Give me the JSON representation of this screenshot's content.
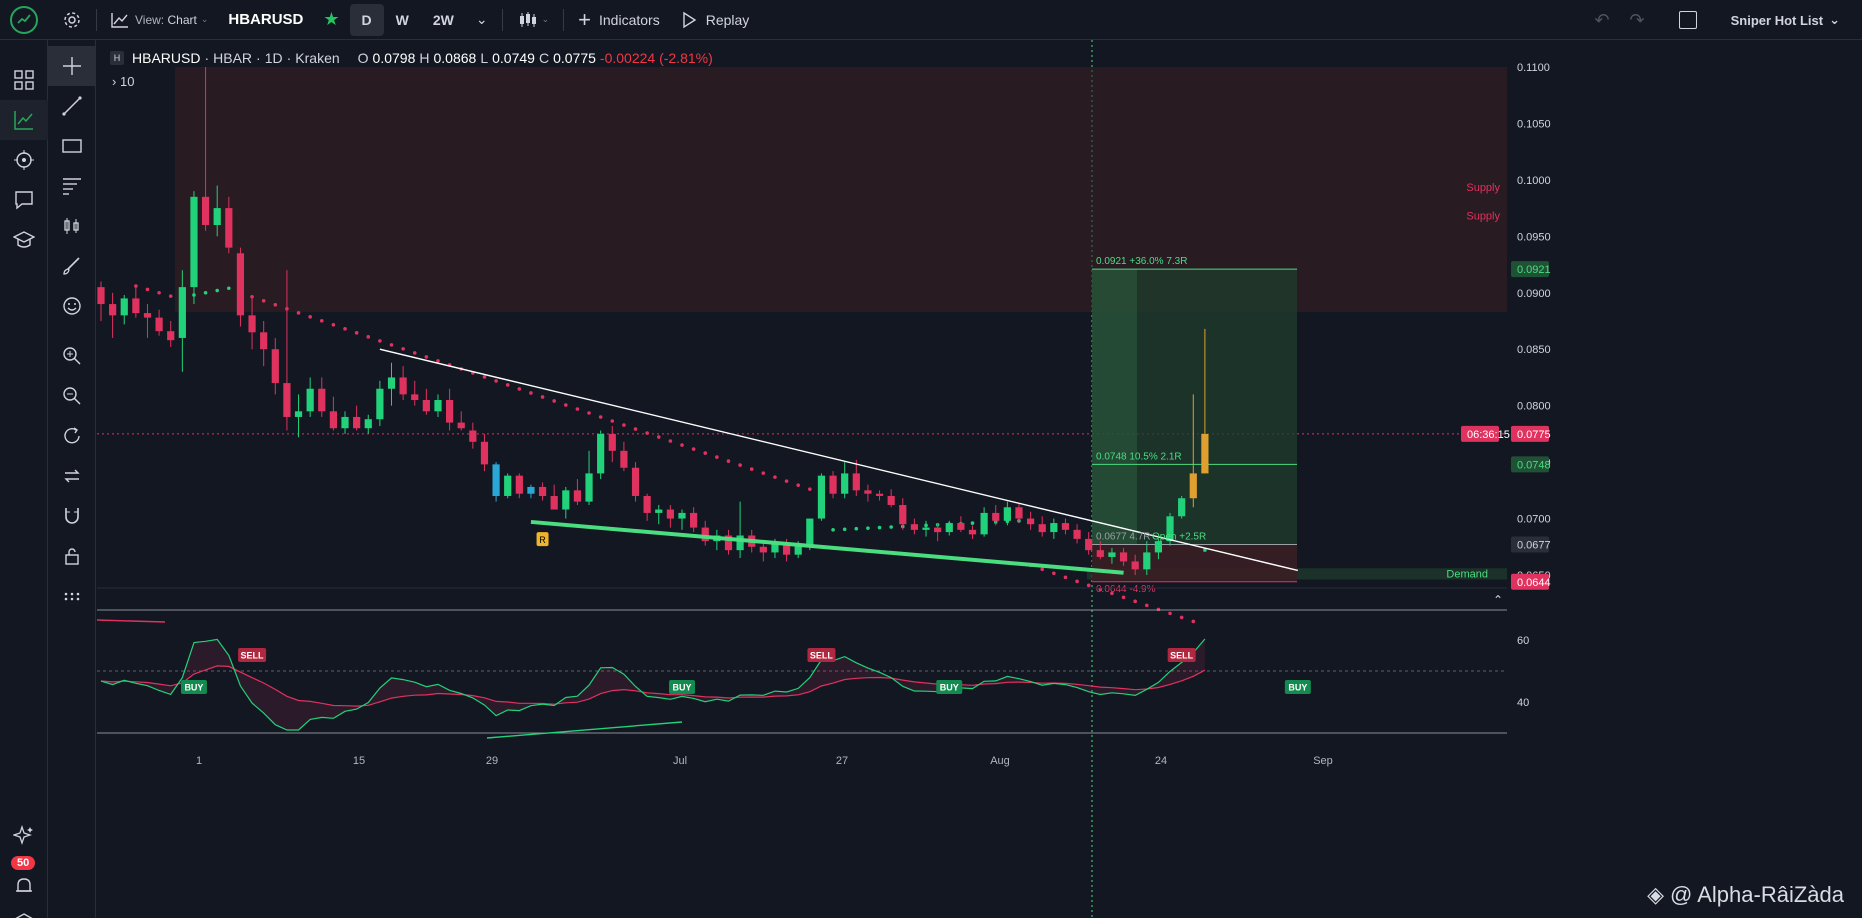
{
  "topbar": {
    "view_label": "View:",
    "view_value": "Chart",
    "symbol": "HBARUSD",
    "timeframes": [
      "D",
      "W",
      "2W"
    ],
    "active_timeframe": "D",
    "indicators_label": "Indicators",
    "replay_label": "Replay",
    "watchlist_label": "Sniper Hot List"
  },
  "legend": {
    "symbol": "HBARUSD",
    "base": "HBAR",
    "interval": "1D",
    "exchange": "Kraken",
    "o_label": "O",
    "o": "0.0798",
    "h_label": "H",
    "h": "0.0868",
    "l_label": "L",
    "l": "0.0749",
    "c_label": "C",
    "c": "0.0775",
    "change": "-0.00224 (-2.81%)",
    "indicator_count": "10"
  },
  "notifications": {
    "count": "50"
  },
  "colors": {
    "up": "#22d27a",
    "down": "#e0325f",
    "bg": "#131722",
    "grid": "#2a2e39",
    "supply": "#3a1f23",
    "long_profit": "#1f3d2c",
    "long_loss": "#3a1f23",
    "trend": "#ffffff",
    "support": "#4ade80"
  },
  "chart_data": {
    "type": "candlestick",
    "price_ticks": [
      "0.1100",
      "0.1050",
      "0.1000",
      "0.0950",
      "0.0900",
      "0.0850",
      "0.0800",
      "0.0750",
      "0.0700",
      "0.0650"
    ],
    "time_ticks": [
      "1",
      "15",
      "29",
      "Jul",
      "27",
      "Aug",
      "24",
      "Sep"
    ],
    "zones": {
      "supply_labels": [
        "Supply",
        "Supply"
      ],
      "demand_label": "Demand"
    },
    "position": {
      "target": "0.0921 +36.0% 7.3R",
      "mid": "0.0748 10.5% 2.1R",
      "entry": "0.0677 4.7R",
      "open": "Open +2.5R",
      "stop": "0.0644 -4.9%"
    },
    "price_labels": {
      "target": "0.0921",
      "current": "0.0775",
      "countdown": "06:36:15",
      "mid": "0.0748",
      "entry": "0.0677",
      "demand": "0.0644"
    },
    "oscillator": {
      "ticks": [
        "60",
        "40"
      ],
      "signals": [
        {
          "type": "BUY",
          "t": 8
        },
        {
          "type": "SELL",
          "t": 13
        },
        {
          "type": "BUY",
          "t": 50
        },
        {
          "type": "SELL",
          "t": 62
        },
        {
          "type": "BUY",
          "t": 73
        },
        {
          "type": "SELL",
          "t": 93
        },
        {
          "type": "BUY",
          "t": 103
        }
      ]
    },
    "r_label": "R",
    "candles": [
      [
        0.0905,
        0.091,
        0.0875,
        0.089
      ],
      [
        0.089,
        0.09,
        0.086,
        0.088
      ],
      [
        0.088,
        0.0898,
        0.0872,
        0.0895
      ],
      [
        0.0895,
        0.0905,
        0.0878,
        0.0882
      ],
      [
        0.0882,
        0.089,
        0.086,
        0.0878
      ],
      [
        0.0878,
        0.0885,
        0.0862,
        0.0866
      ],
      [
        0.0866,
        0.0875,
        0.0852,
        0.0858
      ],
      [
        0.086,
        0.092,
        0.083,
        0.0905
      ],
      [
        0.0905,
        0.099,
        0.089,
        0.0985
      ],
      [
        0.0985,
        0.11,
        0.0955,
        0.096
      ],
      [
        0.096,
        0.0995,
        0.095,
        0.0975
      ],
      [
        0.0975,
        0.0985,
        0.0935,
        0.094
      ],
      [
        0.0935,
        0.094,
        0.087,
        0.088
      ],
      [
        0.088,
        0.0895,
        0.085,
        0.0865
      ],
      [
        0.0865,
        0.0875,
        0.0835,
        0.085
      ],
      [
        0.085,
        0.086,
        0.081,
        0.082
      ],
      [
        0.082,
        0.092,
        0.0778,
        0.079
      ],
      [
        0.079,
        0.081,
        0.0772,
        0.0795
      ],
      [
        0.0795,
        0.0825,
        0.079,
        0.0815
      ],
      [
        0.0815,
        0.0825,
        0.079,
        0.0795
      ],
      [
        0.0795,
        0.0808,
        0.0778,
        0.078
      ],
      [
        0.078,
        0.0795,
        0.0775,
        0.079
      ],
      [
        0.079,
        0.08,
        0.0778,
        0.078
      ],
      [
        0.078,
        0.0792,
        0.0775,
        0.0788
      ],
      [
        0.0788,
        0.0822,
        0.0782,
        0.0815
      ],
      [
        0.0815,
        0.0838,
        0.08,
        0.0825
      ],
      [
        0.0825,
        0.0835,
        0.0805,
        0.081
      ],
      [
        0.081,
        0.0822,
        0.08,
        0.0805
      ],
      [
        0.0805,
        0.0815,
        0.0792,
        0.0795
      ],
      [
        0.0795,
        0.081,
        0.079,
        0.0805
      ],
      [
        0.0805,
        0.0815,
        0.0778,
        0.0785
      ],
      [
        0.0785,
        0.0795,
        0.0778,
        0.078
      ],
      [
        0.0778,
        0.0785,
        0.0762,
        0.0768
      ],
      [
        0.0768,
        0.0775,
        0.0742,
        0.0748
      ],
      [
        0.0748,
        0.075,
        0.0715,
        0.072
      ],
      [
        0.072,
        0.074,
        0.0718,
        0.0738
      ],
      [
        0.0738,
        0.074,
        0.0718,
        0.0722
      ],
      [
        0.0722,
        0.073,
        0.0718,
        0.0728
      ],
      [
        0.0728,
        0.0732,
        0.0716,
        0.072
      ],
      [
        0.072,
        0.073,
        0.071,
        0.0708
      ],
      [
        0.0708,
        0.0728,
        0.07,
        0.0725
      ],
      [
        0.0725,
        0.0735,
        0.0712,
        0.0715
      ],
      [
        0.0715,
        0.076,
        0.0712,
        0.074
      ],
      [
        0.074,
        0.0778,
        0.0735,
        0.0775
      ],
      [
        0.0775,
        0.0782,
        0.075,
        0.076
      ],
      [
        0.076,
        0.0768,
        0.0742,
        0.0745
      ],
      [
        0.0745,
        0.075,
        0.0715,
        0.072
      ],
      [
        0.072,
        0.0722,
        0.0698,
        0.0705
      ],
      [
        0.0705,
        0.0712,
        0.0695,
        0.0708
      ],
      [
        0.0708,
        0.0712,
        0.0692,
        0.07
      ],
      [
        0.07,
        0.0708,
        0.069,
        0.0705
      ],
      [
        0.0705,
        0.071,
        0.0688,
        0.0692
      ],
      [
        0.0692,
        0.0698,
        0.0676,
        0.068
      ],
      [
        0.068,
        0.069,
        0.0672,
        0.0685
      ],
      [
        0.0685,
        0.069,
        0.0668,
        0.0672
      ],
      [
        0.0672,
        0.0715,
        0.0665,
        0.0685
      ],
      [
        0.0685,
        0.069,
        0.067,
        0.0675
      ],
      [
        0.0675,
        0.068,
        0.0662,
        0.067
      ],
      [
        0.067,
        0.0682,
        0.0665,
        0.0678
      ],
      [
        0.0678,
        0.0682,
        0.0662,
        0.0668
      ],
      [
        0.0668,
        0.068,
        0.0665,
        0.0676
      ],
      [
        0.0676,
        0.07,
        0.0672,
        0.07
      ],
      [
        0.07,
        0.074,
        0.0698,
        0.0738
      ],
      [
        0.0738,
        0.0742,
        0.0718,
        0.0722
      ],
      [
        0.0722,
        0.075,
        0.0718,
        0.074
      ],
      [
        0.074,
        0.0752,
        0.072,
        0.0725
      ],
      [
        0.0725,
        0.073,
        0.0715,
        0.0722
      ],
      [
        0.0722,
        0.0725,
        0.0716,
        0.072
      ],
      [
        0.072,
        0.0726,
        0.071,
        0.0712
      ],
      [
        0.0712,
        0.0718,
        0.069,
        0.0695
      ],
      [
        0.0695,
        0.07,
        0.0686,
        0.069
      ],
      [
        0.069,
        0.0698,
        0.0684,
        0.0692
      ],
      [
        0.0692,
        0.0696,
        0.068,
        0.0688
      ],
      [
        0.0688,
        0.0698,
        0.0685,
        0.0696
      ],
      [
        0.0696,
        0.0702,
        0.0688,
        0.069
      ],
      [
        0.069,
        0.0694,
        0.0682,
        0.0686
      ],
      [
        0.0686,
        0.071,
        0.0684,
        0.0705
      ],
      [
        0.0705,
        0.0712,
        0.0694,
        0.0698
      ],
      [
        0.0698,
        0.0715,
        0.0694,
        0.071
      ],
      [
        0.071,
        0.0714,
        0.0696,
        0.07
      ],
      [
        0.07,
        0.0706,
        0.069,
        0.0695
      ],
      [
        0.0695,
        0.0702,
        0.0684,
        0.0688
      ],
      [
        0.0688,
        0.07,
        0.0682,
        0.0696
      ],
      [
        0.0696,
        0.07,
        0.0686,
        0.069
      ],
      [
        0.069,
        0.0695,
        0.0678,
        0.0682
      ],
      [
        0.0682,
        0.0688,
        0.0668,
        0.0672
      ],
      [
        0.0672,
        0.068,
        0.0664,
        0.0666
      ],
      [
        0.0666,
        0.0674,
        0.066,
        0.067
      ],
      [
        0.067,
        0.0674,
        0.0658,
        0.0662
      ],
      [
        0.0662,
        0.0668,
        0.065,
        0.0655
      ],
      [
        0.0655,
        0.068,
        0.065,
        0.067
      ],
      [
        0.067,
        0.0682,
        0.0664,
        0.068
      ],
      [
        0.068,
        0.0705,
        0.0676,
        0.0702
      ],
      [
        0.0702,
        0.072,
        0.07,
        0.0718
      ],
      [
        0.0718,
        0.081,
        0.071,
        0.074
      ],
      [
        0.074,
        0.0868,
        0.0749,
        0.0775
      ]
    ]
  }
}
